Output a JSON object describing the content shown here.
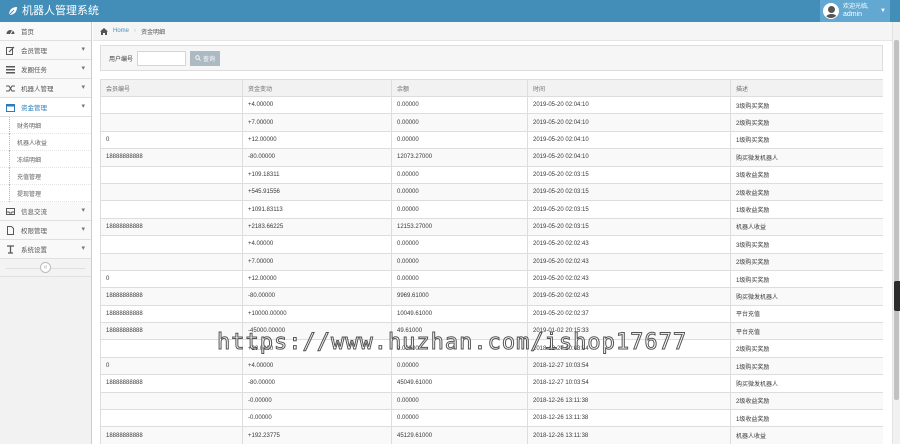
{
  "app": {
    "title": "机器人管理系统"
  },
  "user": {
    "greeting": "欢迎光临,",
    "name": "admin"
  },
  "sidebar": {
    "items": [
      {
        "label": "首页",
        "icon": "tachometer-icon",
        "expanded": false,
        "chev": ""
      },
      {
        "label": "会员管理",
        "icon": "edit-icon",
        "chev": "▾"
      },
      {
        "label": "发圈任务",
        "icon": "list-icon",
        "chev": "▾"
      },
      {
        "label": "机器人管理",
        "icon": "random-icon",
        "chev": "▾"
      },
      {
        "label": "资金管理",
        "icon": "calendar-icon",
        "chev": "▾",
        "active": true,
        "children": [
          "财务明细",
          "机器人收益",
          "冻结明细",
          "充值管理",
          "提现管理"
        ]
      },
      {
        "label": "信息交流",
        "icon": "inbox-icon",
        "chev": "▾"
      },
      {
        "label": "权限管理",
        "icon": "file-icon",
        "chev": "▾"
      },
      {
        "label": "系统设置",
        "icon": "wrench-icon",
        "chev": "▾"
      }
    ],
    "collapse_label": "«"
  },
  "breadcrumb": {
    "home": "Home",
    "current": "资金明细"
  },
  "search": {
    "label": "用户编号",
    "input_value": "",
    "button": "查询"
  },
  "table": {
    "headers": [
      "会员编号",
      "资金变动",
      "余额",
      "时间",
      "描述"
    ],
    "rows": [
      [
        "",
        "+4.00000",
        "0.00000",
        "2019-05-20 02:04:10",
        "3级购买奖励"
      ],
      [
        "",
        "+7.00000",
        "0.00000",
        "2019-05-20 02:04:10",
        "2级购买奖励"
      ],
      [
        "0",
        "+12.00000",
        "0.00000",
        "2019-05-20 02:04:10",
        "1级购买奖励"
      ],
      [
        "18888888888",
        "-80.00000",
        "12073.27000",
        "2019-05-20 02:04:10",
        "购买微发机器人"
      ],
      [
        "",
        "+109.18311",
        "0.00000",
        "2019-05-20 02:03:15",
        "3级收益奖励"
      ],
      [
        "",
        "+545.91556",
        "0.00000",
        "2019-05-20 02:03:15",
        "2级收益奖励"
      ],
      [
        "",
        "+1091.83113",
        "0.00000",
        "2019-05-20 02:03:15",
        "1级收益奖励"
      ],
      [
        "18888888888",
        "+2183.66225",
        "12153.27000",
        "2019-05-20 02:03:15",
        "机器人收益"
      ],
      [
        "",
        "+4.00000",
        "0.00000",
        "2019-05-20 02:02:43",
        "3级购买奖励"
      ],
      [
        "",
        "+7.00000",
        "0.00000",
        "2019-05-20 02:02:43",
        "2级购买奖励"
      ],
      [
        "0",
        "+12.00000",
        "0.00000",
        "2019-05-20 02:02:43",
        "1级购买奖励"
      ],
      [
        "18888888888",
        "-80.00000",
        "9969.61000",
        "2019-05-20 02:02:43",
        "购买微发机器人"
      ],
      [
        "18888888888",
        "+10000.00000",
        "10049.61000",
        "2019-05-20 02:02:37",
        "平台充值"
      ],
      [
        "18888888888",
        "-45000.00000",
        "49.61000",
        "2019-01-02 20:15:33",
        "平台充值"
      ],
      [
        "",
        "+20.0000",
        "0.00000",
        "2018-12-27 10:03:54",
        "2级购买奖励"
      ],
      [
        "0",
        "+4.00000",
        "0.00000",
        "2018-12-27 10:03:54",
        "1级购买奖励"
      ],
      [
        "18888888888",
        "-80.00000",
        "45049.61000",
        "2018-12-27 10:03:54",
        "购买微发机器人"
      ],
      [
        "",
        "-0.00000",
        "0.00000",
        "2018-12-26 13:11:38",
        "2级收益奖励"
      ],
      [
        "",
        "-0.00000",
        "0.00000",
        "2018-12-26 13:11:38",
        "1级收益奖励"
      ],
      [
        "18888888888",
        "+192.23775",
        "45129.61000",
        "2018-12-26 13:11:38",
        "机器人收益"
      ]
    ]
  },
  "watermark": "https://www.huzhan.com/ishop17677"
}
